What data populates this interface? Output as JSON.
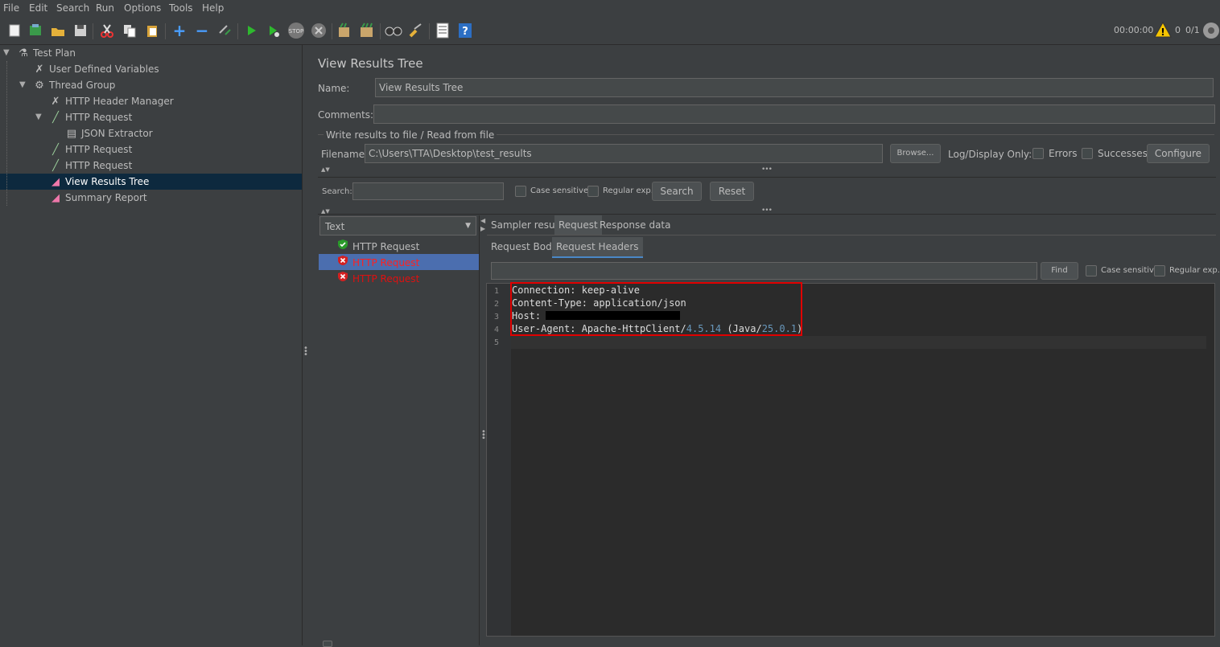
{
  "menu": [
    "File",
    "Edit",
    "Search",
    "Run",
    "Options",
    "Tools",
    "Help"
  ],
  "status": {
    "time": "00:00:00",
    "warnings": "0",
    "threads": "0/1"
  },
  "tree": [
    {
      "label": "Test Plan",
      "icon": "flask-icon"
    },
    {
      "label": "User Defined Variables",
      "icon": "wrench-icon"
    },
    {
      "label": "Thread Group",
      "icon": "gear-icon"
    },
    {
      "label": "HTTP Header Manager",
      "icon": "wrench-icon"
    },
    {
      "label": "HTTP Request",
      "icon": "pipette-icon"
    },
    {
      "label": "JSON Extractor",
      "icon": "document-icon"
    },
    {
      "label": "HTTP Request",
      "icon": "pipette-icon"
    },
    {
      "label": "HTTP Request",
      "icon": "pipette-icon"
    },
    {
      "label": "View Results Tree",
      "icon": "chart-icon"
    },
    {
      "label": "Summary Report",
      "icon": "chart-icon"
    }
  ],
  "panel": {
    "title": "View Results Tree",
    "name_label": "Name:",
    "name_value": "View Results Tree",
    "comments_label": "Comments:",
    "write_results": "Write results to file / Read from file",
    "filename_label": "Filename",
    "filename_value": "C:\\Users\\TTA\\Desktop\\test_results",
    "browse": "Browse...",
    "log_display": "Log/Display Only:",
    "errors": "Errors",
    "successes": "Successes",
    "configure": "Configure",
    "search_label": "Search:",
    "case_sensitive": "Case sensitive",
    "regular_exp": "Regular exp.",
    "search_btn": "Search",
    "reset_btn": "Reset"
  },
  "results": {
    "renderer": "Text",
    "items": [
      {
        "label": "HTTP Request",
        "status": "success"
      },
      {
        "label": "HTTP Request",
        "status": "error"
      },
      {
        "label": "HTTP Request",
        "status": "error"
      }
    ]
  },
  "tabs": {
    "main": [
      "Sampler result",
      "Request",
      "Response data"
    ],
    "sub": [
      "Request Body",
      "Request Headers"
    ],
    "find": "Find",
    "case_sensitive": "Case sensitive",
    "regular_exp": "Regular exp."
  },
  "headers": {
    "line_numbers": [
      "1",
      "2",
      "3",
      "4",
      "5"
    ],
    "l1": "Connection: keep-alive",
    "l2": "Content-Type: application/json",
    "l3": "Host: ",
    "l4a": "User-Agent: Apache-HttpClient/",
    "l4b": "4.5.14",
    "l4c": " (Java/",
    "l4d": "25.0.1",
    "l4e": ")"
  },
  "colors": {
    "accent": "#4b6eaf",
    "error": "#e01010",
    "highlight_box": "#e00000"
  }
}
